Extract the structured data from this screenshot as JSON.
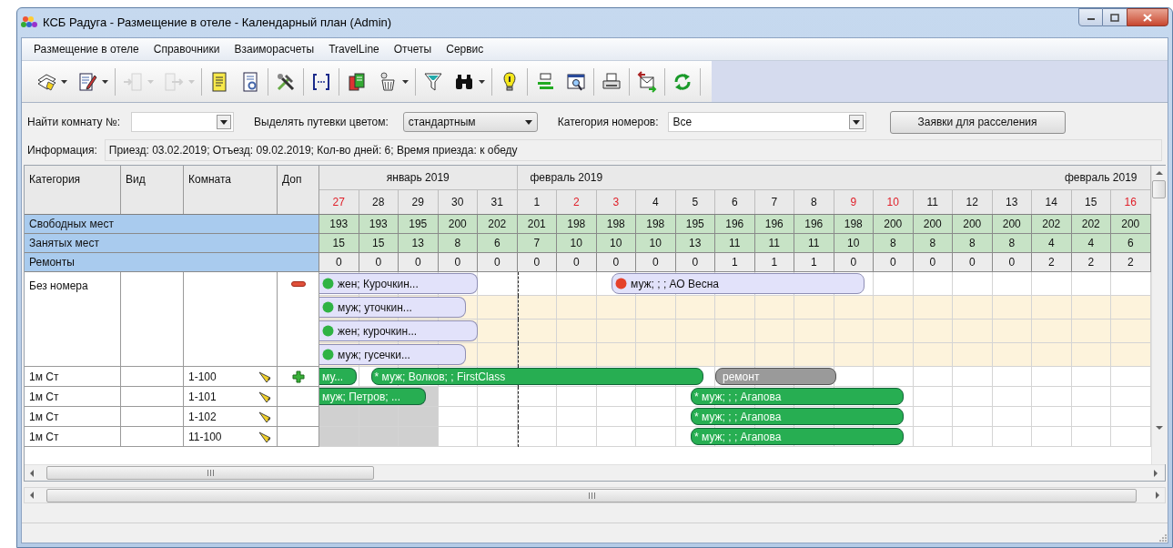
{
  "window": {
    "title": "КСБ Радуга - Размещение в отеле - Календарный план (Admin)"
  },
  "menu": [
    "Размещение в отеле",
    "Справочники",
    "Взаиморасчеты",
    "TravelLine",
    "Отчеты",
    "Сервис"
  ],
  "toolbar": [
    {
      "dropdown": true,
      "disabled": false,
      "separator_after": false
    },
    {
      "dropdown": true,
      "disabled": false,
      "separator_after": true
    },
    {
      "dropdown": true,
      "disabled": true,
      "separator_after": false
    },
    {
      "dropdown": true,
      "disabled": true,
      "separator_after": true
    },
    {
      "dropdown": false,
      "disabled": false,
      "separator_after": false
    },
    {
      "dropdown": false,
      "disabled": false,
      "separator_after": true
    },
    {
      "dropdown": false,
      "disabled": false,
      "separator_after": true
    },
    {
      "dropdown": false,
      "disabled": false,
      "separator_after": true
    },
    {
      "dropdown": false,
      "disabled": false,
      "separator_after": false
    },
    {
      "dropdown": true,
      "disabled": false,
      "separator_after": true
    },
    {
      "dropdown": false,
      "disabled": false,
      "separator_after": false
    },
    {
      "dropdown": true,
      "disabled": false,
      "separator_after": true
    },
    {
      "dropdown": false,
      "disabled": false,
      "separator_after": true
    },
    {
      "dropdown": false,
      "disabled": false,
      "separator_after": false
    },
    {
      "dropdown": false,
      "disabled": false,
      "separator_after": true
    },
    {
      "dropdown": false,
      "disabled": false,
      "separator_after": true
    },
    {
      "dropdown": false,
      "disabled": false,
      "separator_after": true
    },
    {
      "dropdown": false,
      "disabled": false,
      "separator_after": true
    }
  ],
  "filters": {
    "room_label": "Найти комнату №:",
    "color_label": "Выделять путевки цветом:",
    "color_value": "стандартным",
    "category_label": "Категория номеров:",
    "category_value": "Все",
    "button": "Заявки для расселения"
  },
  "info": {
    "label": "Информация:",
    "value": "Приезд: 03.02.2019; Отъезд: 09.02.2019; Кол-во дней: 6; Время приезда: к обеду"
  },
  "calendar": {
    "columns": [
      "Категория",
      "Вид",
      "Комната",
      "Доп"
    ],
    "months": [
      {
        "labels": [
          "январь 2019"
        ],
        "days": [
          {
            "label": "27",
            "weekend": true
          },
          {
            "label": "28",
            "weekend": false
          },
          {
            "label": "29",
            "weekend": false
          },
          {
            "label": "30",
            "weekend": false
          },
          {
            "label": "31",
            "weekend": false
          }
        ]
      },
      {
        "labels": [
          "февраль 2019",
          "февраль 2019"
        ],
        "days": [
          {
            "label": "1",
            "weekend": false
          },
          {
            "label": "2",
            "weekend": true
          },
          {
            "label": "3",
            "weekend": true
          },
          {
            "label": "4",
            "weekend": false
          },
          {
            "label": "5",
            "weekend": false
          },
          {
            "label": "6",
            "weekend": false
          },
          {
            "label": "7",
            "weekend": false
          },
          {
            "label": "8",
            "weekend": false
          },
          {
            "label": "9",
            "weekend": true
          },
          {
            "label": "10",
            "weekend": true
          },
          {
            "label": "11",
            "weekend": false
          },
          {
            "label": "12",
            "weekend": false
          },
          {
            "label": "13",
            "weekend": false
          },
          {
            "label": "14",
            "weekend": false
          },
          {
            "label": "15",
            "weekend": false
          },
          {
            "label": "16",
            "weekend": true
          }
        ]
      }
    ],
    "stats": [
      {
        "kind": "free",
        "label": "Свободных мест",
        "values": [
          "193",
          "193",
          "195",
          "200",
          "202",
          "201",
          "198",
          "198",
          "198",
          "195",
          "196",
          "196",
          "196",
          "198",
          "200",
          "200",
          "200",
          "200",
          "202",
          "202",
          "200"
        ]
      },
      {
        "kind": "occupied",
        "label": "Занятых мест",
        "values": [
          "15",
          "15",
          "13",
          "8",
          "6",
          "7",
          "10",
          "10",
          "10",
          "13",
          "11",
          "11",
          "11",
          "10",
          "8",
          "8",
          "8",
          "8",
          "4",
          "4",
          "6"
        ]
      },
      {
        "kind": "repairs",
        "label": "Ремонты",
        "values": [
          "0",
          "0",
          "0",
          "0",
          "0",
          "0",
          "0",
          "0",
          "0",
          "0",
          "1",
          "1",
          "1",
          "0",
          "0",
          "0",
          "0",
          "0",
          "2",
          "2",
          "2"
        ]
      }
    ],
    "unassigned": {
      "category": "Без номера",
      "removable": true,
      "lines": [
        {
          "highlighted": false,
          "bars": [
            {
              "kind": "request",
              "text": "жен; Курочкин...",
              "color": "#2fb344",
              "continues_left": true
            },
            {
              "kind": "request",
              "text": "муж; ; ; АО Весна",
              "color": "#e5412b",
              "continues_left": false
            }
          ]
        },
        {
          "highlighted": true,
          "bars": [
            {
              "kind": "request",
              "text": "муж; уточкин...",
              "color": "#2fb344",
              "continues_left": true
            }
          ]
        },
        {
          "highlighted": true,
          "bars": [
            {
              "kind": "request",
              "text": "жен; курочкин...",
              "color": "#2fb344",
              "continues_left": true
            }
          ]
        },
        {
          "highlighted": true,
          "bars": [
            {
              "kind": "request",
              "text": "муж; гусечки...",
              "color": "#2fb344",
              "continues_left": true
            }
          ]
        }
      ]
    },
    "rooms": [
      {
        "category": "1м Ст",
        "room": "1-100",
        "addable": true,
        "past_shaded": false,
        "bars": [
          {
            "kind": "booking",
            "text": "му...",
            "continues_left": true
          },
          {
            "kind": "booking",
            "text": "* муж; Волков; ; FirstClass",
            "continues_left": false
          },
          {
            "kind": "repair",
            "text": "ремонт",
            "continues_left": false
          }
        ]
      },
      {
        "category": "1м Ст",
        "room": "1-101",
        "addable": false,
        "past_shaded": true,
        "bars": [
          {
            "kind": "booking",
            "text": "муж; Петров; ...",
            "continues_left": true
          },
          {
            "kind": "booking",
            "text": "* муж; ; ; Агапова",
            "continues_left": false
          }
        ]
      },
      {
        "category": "1м Ст",
        "room": "1-102",
        "addable": false,
        "past_shaded": true,
        "bars": [
          {
            "kind": "booking",
            "text": "* муж; ; ; Агапова",
            "continues_left": false
          }
        ]
      },
      {
        "category": "1м Ст",
        "room": "11-100",
        "addable": false,
        "past_shaded": true,
        "bars": [
          {
            "kind": "booking",
            "text": "* муж; ; ; Агапова",
            "continues_left": false
          }
        ]
      }
    ]
  }
}
